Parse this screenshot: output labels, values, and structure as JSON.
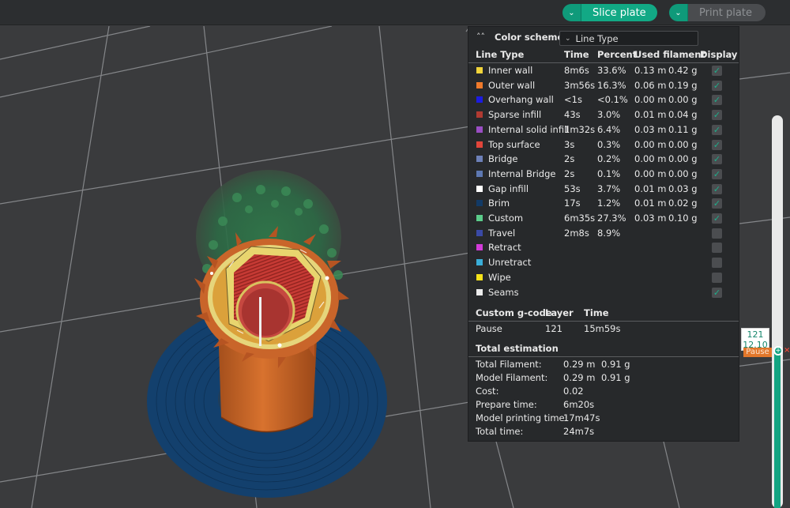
{
  "toolbar": {
    "slice_label": "Slice plate",
    "print_label": "Print plate",
    "dropdown_icon": "chevron-down-icon",
    "colors": {
      "accent": "#12a985",
      "disabled": "#4a4c4f"
    }
  },
  "legend": {
    "scheme_label": "Color scheme",
    "scheme_value": "Line Type",
    "headers": {
      "type": "Line Type",
      "time": "Time",
      "percent": "Percent",
      "filament": "Used filament",
      "display": "Display"
    },
    "rows": [
      {
        "name": "Inner wall",
        "color": "#f1d43a",
        "time": "8m6s",
        "percent": "33.6%",
        "m": "0.13 m",
        "g": "0.42 g",
        "checked": true
      },
      {
        "name": "Outer wall",
        "color": "#f07a2b",
        "time": "3m56s",
        "percent": "16.3%",
        "m": "0.06 m",
        "g": "0.19 g",
        "checked": true
      },
      {
        "name": "Overhang wall",
        "color": "#1c1ce0",
        "time": "<1s",
        "percent": "<0.1%",
        "m": "0.00 m",
        "g": "0.00 g",
        "checked": true
      },
      {
        "name": "Sparse infill",
        "color": "#b03a32",
        "time": "43s",
        "percent": "3.0%",
        "m": "0.01 m",
        "g": "0.04 g",
        "checked": true
      },
      {
        "name": "Internal solid infill",
        "color": "#9a4ec4",
        "time": "1m32s",
        "percent": "6.4%",
        "m": "0.03 m",
        "g": "0.11 g",
        "checked": true
      },
      {
        "name": "Top surface",
        "color": "#e0453a",
        "time": "3s",
        "percent": "0.3%",
        "m": "0.00 m",
        "g": "0.00 g",
        "checked": true
      },
      {
        "name": "Bridge",
        "color": "#6d80b8",
        "time": "2s",
        "percent": "0.2%",
        "m": "0.00 m",
        "g": "0.00 g",
        "checked": true
      },
      {
        "name": "Internal Bridge",
        "color": "#5d78b2",
        "time": "2s",
        "percent": "0.1%",
        "m": "0.00 m",
        "g": "0.00 g",
        "checked": true
      },
      {
        "name": "Gap infill",
        "color": "#ffffff",
        "time": "53s",
        "percent": "3.7%",
        "m": "0.01 m",
        "g": "0.03 g",
        "checked": true
      },
      {
        "name": "Brim",
        "color": "#123a66",
        "time": "17s",
        "percent": "1.2%",
        "m": "0.01 m",
        "g": "0.02 g",
        "checked": true
      },
      {
        "name": "Custom",
        "color": "#5bcc8a",
        "time": "6m35s",
        "percent": "27.3%",
        "m": "0.03 m",
        "g": "0.10 g",
        "checked": true
      },
      {
        "name": "Travel",
        "color": "#3a4aa6",
        "time": "2m8s",
        "percent": "8.9%",
        "m": "",
        "g": "",
        "checked": false
      },
      {
        "name": "Retract",
        "color": "#d23ad8",
        "time": "",
        "percent": "",
        "m": "",
        "g": "",
        "checked": false
      },
      {
        "name": "Unretract",
        "color": "#3aaed8",
        "time": "",
        "percent": "",
        "m": "",
        "g": "",
        "checked": false
      },
      {
        "name": "Wipe",
        "color": "#f6e31a",
        "time": "",
        "percent": "",
        "m": "",
        "g": "",
        "checked": false
      },
      {
        "name": "Seams",
        "color": "#ececec",
        "time": "",
        "percent": "",
        "m": "",
        "g": "",
        "checked": true
      }
    ],
    "custom_gcode": {
      "headers": {
        "name": "Custom g-code",
        "layer": "Layer",
        "time": "Time"
      },
      "rows": [
        {
          "name": "Pause",
          "layer": "121",
          "time": "15m59s"
        }
      ]
    },
    "total": {
      "title": "Total estimation",
      "rows": [
        {
          "label": "Total Filament:",
          "v1": "0.29 m",
          "v2": "0.91 g"
        },
        {
          "label": "Model Filament:",
          "v1": "0.29 m",
          "v2": "0.91 g"
        },
        {
          "label": "Cost:",
          "v1": "0.02",
          "v2": ""
        },
        {
          "label": "Prepare time:",
          "v1": "6m20s",
          "v2": ""
        },
        {
          "label": "Model printing time:",
          "v1": "17m47s",
          "v2": ""
        },
        {
          "label": "Total time:",
          "v1": "24m7s",
          "v2": ""
        }
      ]
    }
  },
  "layer_slider": {
    "layer": "121",
    "height": "12.10",
    "pause_label": "Pause",
    "current_fraction": 0.41
  }
}
